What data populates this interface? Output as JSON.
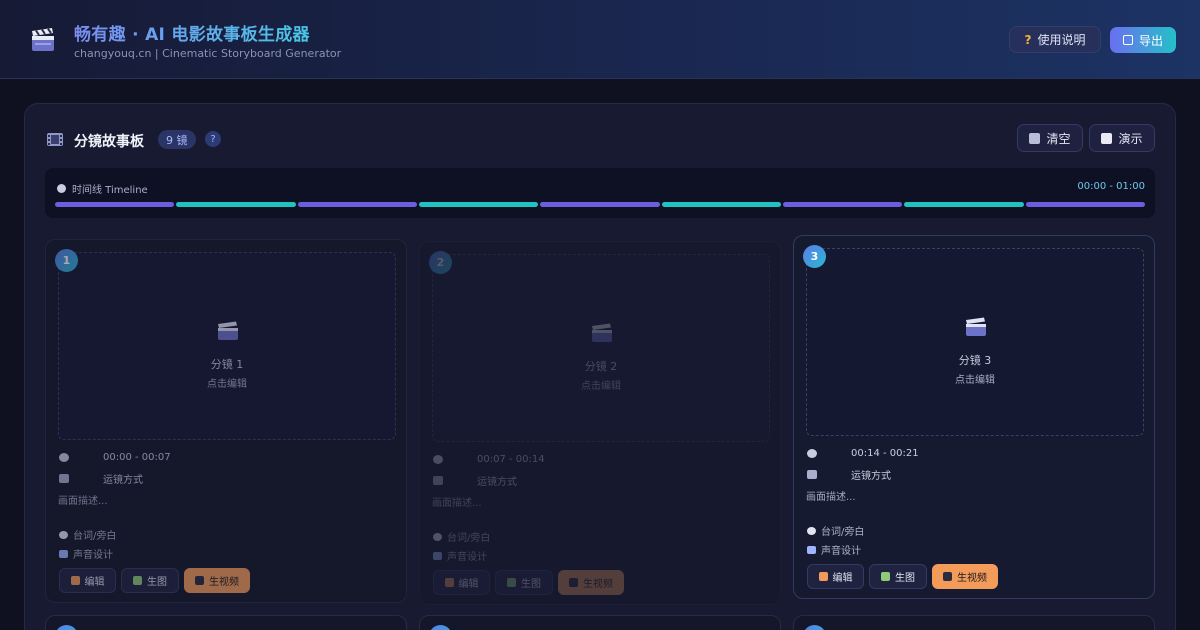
{
  "header": {
    "title": "畅有趣 · AI 电影故事板生成器",
    "subtitle": "changyouq.cn | Cinematic Storyboard Generator",
    "help_label": "使用说明",
    "help_icon_glyph": "?",
    "export_label": "导出"
  },
  "panel": {
    "title": "分镜故事板",
    "count": "9 镜",
    "help_glyph": "?",
    "clear_label": "清空",
    "demo_label": "演示"
  },
  "timeline": {
    "label": "时间线 Timeline",
    "range": "00:00 - 01:00",
    "segment_colors": [
      "#6b5fe0",
      "#20c3c0",
      "#6b5fe0",
      "#20c3c0",
      "#6b5fe0",
      "#20c3c0",
      "#6b5fe0",
      "#20c3c0",
      "#6b5fe0"
    ]
  },
  "scenes": [
    {
      "number": "1",
      "preview_title": "分镜 1",
      "preview_sub": "点击编辑",
      "time": "00:00 - 00:07",
      "camera": "运镜方式",
      "description": "画面描述...",
      "dialogue": "台词/旁白",
      "sound": "声音设计",
      "edit_label": "编辑",
      "image_label": "生图",
      "video_label": "生视频"
    },
    {
      "number": "2",
      "preview_title": "分镜 2",
      "preview_sub": "点击编辑",
      "time": "00:07 - 00:14",
      "camera": "运镜方式",
      "description": "画面描述...",
      "dialogue": "台词/旁白",
      "sound": "声音设计",
      "edit_label": "编辑",
      "image_label": "生图",
      "video_label": "生视频"
    },
    {
      "number": "3",
      "preview_title": "分镜 3",
      "preview_sub": "点击编辑",
      "time": "00:14 - 00:21",
      "camera": "运镜方式",
      "description": "画面描述...",
      "dialogue": "台词/旁白",
      "sound": "声音设计",
      "edit_label": "编辑",
      "image_label": "生图",
      "video_label": "生视频"
    }
  ],
  "colors": {
    "accent_purple": "#6b5fe0",
    "accent_teal": "#20c3c0",
    "video_button": "#f39c5a"
  }
}
